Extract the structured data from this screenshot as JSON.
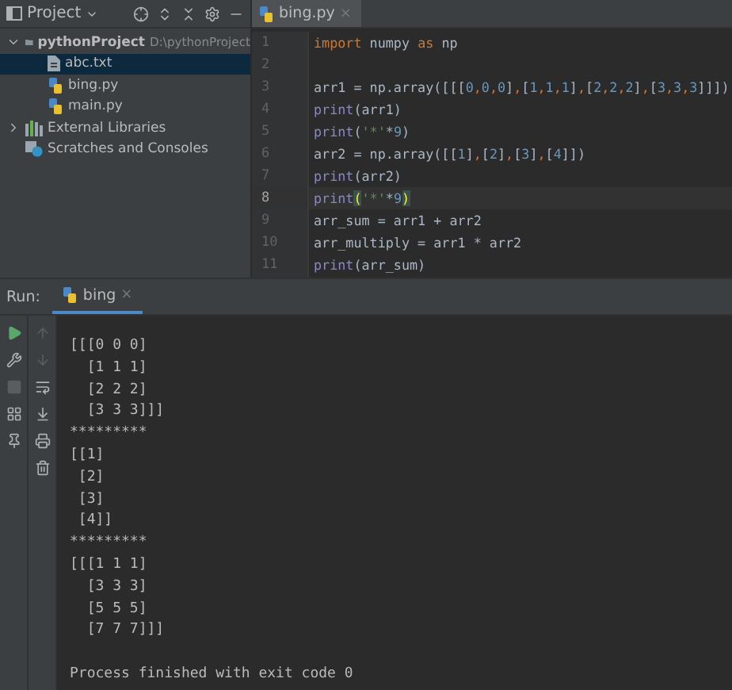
{
  "project_panel": {
    "title": "Project",
    "tree": [
      {
        "label": "pythonProject",
        "path": "D:\\pythonProject",
        "kind": "folder",
        "expanded": true,
        "selected": false,
        "children": [
          {
            "label": "abc.txt",
            "kind": "text",
            "selected": true
          },
          {
            "label": "bing.py",
            "kind": "python",
            "selected": false
          },
          {
            "label": "main.py",
            "kind": "python",
            "selected": false
          }
        ]
      },
      {
        "label": "External Libraries",
        "kind": "library",
        "expanded": false,
        "selected": false
      },
      {
        "label": "Scratches and Consoles",
        "kind": "scratch",
        "selected": false
      }
    ]
  },
  "editor": {
    "tabs": [
      {
        "label": "bing.py",
        "selected": true,
        "close": "×"
      }
    ],
    "lines": [
      {
        "number": "1",
        "current": false,
        "segments": [
          {
            "text": "import",
            "kind": "keyword"
          },
          {
            "text": " numpy ",
            "kind": "plain"
          },
          {
            "text": "as",
            "kind": "keyword"
          },
          {
            "text": " np",
            "kind": "plain"
          }
        ]
      },
      {
        "number": "2",
        "current": false
      },
      {
        "number": "3",
        "current": false,
        "segments": [
          {
            "text": "arr1 = np.array([[[",
            "kind": "plain"
          },
          {
            "text": "0",
            "kind": "number"
          },
          {
            "text": ",",
            "kind": "punct"
          },
          {
            "text": "0",
            "kind": "number"
          },
          {
            "text": ",",
            "kind": "punct"
          },
          {
            "text": "0",
            "kind": "number"
          },
          {
            "text": "]",
            "kind": "plain"
          },
          {
            "text": ",",
            "kind": "punct"
          },
          {
            "text": "[",
            "kind": "plain"
          },
          {
            "text": "1",
            "kind": "number"
          },
          {
            "text": ",",
            "kind": "punct"
          },
          {
            "text": "1",
            "kind": "number"
          },
          {
            "text": ",",
            "kind": "punct"
          },
          {
            "text": "1",
            "kind": "number"
          },
          {
            "text": "]",
            "kind": "plain"
          },
          {
            "text": ",",
            "kind": "punct"
          },
          {
            "text": "[",
            "kind": "plain"
          },
          {
            "text": "2",
            "kind": "number"
          },
          {
            "text": ",",
            "kind": "punct"
          },
          {
            "text": "2",
            "kind": "number"
          },
          {
            "text": ",",
            "kind": "punct"
          },
          {
            "text": "2",
            "kind": "number"
          },
          {
            "text": "]",
            "kind": "plain"
          },
          {
            "text": ",",
            "kind": "punct"
          },
          {
            "text": "[",
            "kind": "plain"
          },
          {
            "text": "3",
            "kind": "number"
          },
          {
            "text": ",",
            "kind": "punct"
          },
          {
            "text": "3",
            "kind": "number"
          },
          {
            "text": ",",
            "kind": "punct"
          },
          {
            "text": "3",
            "kind": "number"
          },
          {
            "text": "]]])",
            "kind": "plain"
          }
        ]
      },
      {
        "number": "4",
        "current": false,
        "segments": [
          {
            "text": "print",
            "kind": "builtin"
          },
          {
            "text": "(arr1)",
            "kind": "plain"
          }
        ]
      },
      {
        "number": "5",
        "current": false,
        "segments": [
          {
            "text": "print",
            "kind": "builtin"
          },
          {
            "text": "(",
            "kind": "plain"
          },
          {
            "text": "'*'",
            "kind": "string"
          },
          {
            "text": "*",
            "kind": "plain"
          },
          {
            "text": "9",
            "kind": "number"
          },
          {
            "text": ")",
            "kind": "plain"
          }
        ]
      },
      {
        "number": "6",
        "current": false,
        "segments": [
          {
            "text": "arr2 = np.array([[",
            "kind": "plain"
          },
          {
            "text": "1",
            "kind": "number"
          },
          {
            "text": "]",
            "kind": "plain"
          },
          {
            "text": ",",
            "kind": "punct"
          },
          {
            "text": "[",
            "kind": "plain"
          },
          {
            "text": "2",
            "kind": "number"
          },
          {
            "text": "]",
            "kind": "plain"
          },
          {
            "text": ",",
            "kind": "punct"
          },
          {
            "text": "[",
            "kind": "plain"
          },
          {
            "text": "3",
            "kind": "number"
          },
          {
            "text": "]",
            "kind": "plain"
          },
          {
            "text": ",",
            "kind": "punct"
          },
          {
            "text": "[",
            "kind": "plain"
          },
          {
            "text": "4",
            "kind": "number"
          },
          {
            "text": "]])",
            "kind": "plain"
          }
        ]
      },
      {
        "number": "7",
        "current": false,
        "segments": [
          {
            "text": "print",
            "kind": "builtin"
          },
          {
            "text": "(arr2)",
            "kind": "plain"
          }
        ]
      },
      {
        "number": "8",
        "current": true,
        "segments": [
          {
            "text": "print",
            "kind": "builtin"
          },
          {
            "text": "(",
            "kind": "match"
          },
          {
            "text": "'*'",
            "kind": "string"
          },
          {
            "text": "*",
            "kind": "plain"
          },
          {
            "text": "9",
            "kind": "number"
          },
          {
            "text": ")",
            "kind": "match"
          }
        ]
      },
      {
        "number": "9",
        "current": false,
        "segments": [
          {
            "text": "arr_sum = arr1 + arr2",
            "kind": "plain"
          }
        ]
      },
      {
        "number": "10",
        "current": false,
        "segments": [
          {
            "text": "arr_multiply = arr1 * arr2",
            "kind": "plain"
          }
        ]
      },
      {
        "number": "11",
        "current": false,
        "segments": [
          {
            "text": "print",
            "kind": "builtin"
          },
          {
            "text": "(arr_sum)",
            "kind": "plain"
          }
        ]
      }
    ]
  },
  "run_panel": {
    "label": "Run:",
    "tabs": [
      {
        "label": "bing",
        "selected": true,
        "close": "×"
      }
    ],
    "console": [
      "[[[0 0 0]",
      "  [1 1 1]",
      "  [2 2 2]",
      "  [3 3 3]]]",
      "*********",
      "[[1]",
      " [2]",
      " [3]",
      " [4]]",
      "*********",
      "[[[1 1 1]",
      "  [3 3 3]",
      "  [5 5 5]",
      "  [7 7 7]]]"
    ],
    "status": "Process finished with exit code 0"
  }
}
